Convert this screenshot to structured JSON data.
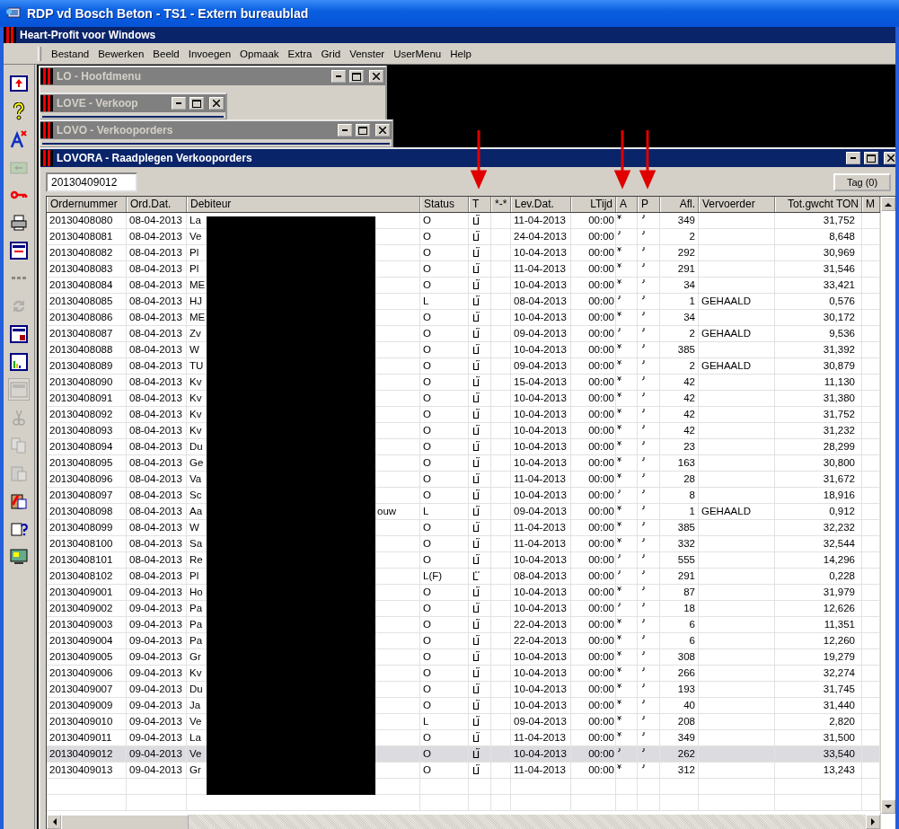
{
  "window": {
    "title": "RDP vd Bosch Beton - TS1 - Extern bureaublad"
  },
  "app_bar": {
    "title": "Heart-Profit voor Windows"
  },
  "menu": [
    "Bestand",
    "Bewerken",
    "Beeld",
    "Invoegen",
    "Opmaak",
    "Extra",
    "Grid",
    "Venster",
    "UserMenu",
    "Help"
  ],
  "toolbar": [
    {
      "kind": "exit",
      "disabled": false
    },
    {
      "kind": "help",
      "disabled": false
    },
    {
      "kind": "font",
      "disabled": false
    },
    {
      "kind": "folder",
      "disabled": true
    },
    {
      "kind": "key",
      "disabled": false
    },
    {
      "kind": "printer",
      "disabled": false
    },
    {
      "kind": "form",
      "disabled": false
    },
    {
      "kind": "dots",
      "disabled": true
    },
    {
      "kind": "refresh",
      "disabled": true
    },
    {
      "kind": "form_lock",
      "disabled": false
    },
    {
      "kind": "chart",
      "disabled": false
    },
    {
      "kind": "window",
      "disabled": true
    },
    {
      "kind": "scissors",
      "disabled": true
    },
    {
      "kind": "copy",
      "disabled": true
    },
    {
      "kind": "paste",
      "disabled": true
    },
    {
      "kind": "clipboard",
      "disabled": false
    },
    {
      "kind": "clipboard_help",
      "disabled": false
    },
    {
      "kind": "monitor",
      "disabled": false
    }
  ],
  "child_windows": [
    {
      "title": "LO - Hoofdmenu"
    },
    {
      "title": "LOVE - Verkoop"
    },
    {
      "title": "LOVO - Verkooporders"
    }
  ],
  "main_window": {
    "title": "LOVORA - Raadplegen Verkooporders",
    "search_value": "20130409012",
    "tag_button": "Tag (0)"
  },
  "table": {
    "columns": [
      "Ordernummer",
      "Ord.Dat.",
      "Debiteur",
      "Status",
      "T",
      "*-*",
      "Lev.Dat.",
      "LTijd",
      "A",
      "P",
      "Afl.",
      "Vervoerder",
      "Tot.gwcht TON",
      "M"
    ],
    "rows": [
      {
        "ordernummer": "20130408080",
        "ord_dat": "08-04-2013",
        "debiteur": "La",
        "status": "O",
        "t_alternate": false,
        "lev_dat": "11-04-2013",
        "ltijd": "00:00",
        "a_marked": true,
        "afl": "349",
        "tot": "31,752",
        "selected": false
      },
      {
        "ordernummer": "20130408081",
        "ord_dat": "08-04-2013",
        "debiteur": "Ve",
        "status": "O",
        "t_alternate": false,
        "lev_dat": "24-04-2013",
        "ltijd": "00:00",
        "a_marked": false,
        "afl": "2",
        "tot": "8,648",
        "selected": false
      },
      {
        "ordernummer": "20130408082",
        "ord_dat": "08-04-2013",
        "debiteur": "Pl",
        "status": "O",
        "t_alternate": false,
        "lev_dat": "10-04-2013",
        "ltijd": "00:00",
        "a_marked": true,
        "afl": "292",
        "tot": "30,969",
        "selected": false
      },
      {
        "ordernummer": "20130408083",
        "ord_dat": "08-04-2013",
        "debiteur": "Pl",
        "status": "O",
        "t_alternate": false,
        "lev_dat": "11-04-2013",
        "ltijd": "00:00",
        "a_marked": true,
        "afl": "291",
        "tot": "31,546",
        "selected": false
      },
      {
        "ordernummer": "20130408084",
        "ord_dat": "08-04-2013",
        "debiteur": "ME",
        "status": "O",
        "t_alternate": false,
        "lev_dat": "10-04-2013",
        "ltijd": "00:00",
        "a_marked": true,
        "afl": "34",
        "tot": "33,421",
        "selected": false
      },
      {
        "ordernummer": "20130408085",
        "ord_dat": "08-04-2013",
        "debiteur": "HJ",
        "status": "L",
        "t_alternate": false,
        "lev_dat": "08-04-2013",
        "ltijd": "00:00",
        "a_marked": false,
        "afl": "1",
        "vervoerder": "GEHAALD",
        "tot": "0,576",
        "selected": false
      },
      {
        "ordernummer": "20130408086",
        "ord_dat": "08-04-2013",
        "debiteur": "ME",
        "status": "O",
        "t_alternate": false,
        "lev_dat": "10-04-2013",
        "ltijd": "00:00",
        "a_marked": true,
        "afl": "34",
        "tot": "30,172",
        "selected": false
      },
      {
        "ordernummer": "20130408087",
        "ord_dat": "08-04-2013",
        "debiteur": "Zv",
        "status": "O",
        "t_alternate": false,
        "lev_dat": "09-04-2013",
        "ltijd": "00:00",
        "a_marked": false,
        "afl": "2",
        "vervoerder": "GEHAALD",
        "tot": "9,536",
        "selected": false
      },
      {
        "ordernummer": "20130408088",
        "ord_dat": "08-04-2013",
        "debiteur": "W",
        "status": "O",
        "t_alternate": false,
        "lev_dat": "10-04-2013",
        "ltijd": "00:00",
        "a_marked": true,
        "afl": "385",
        "tot": "31,392",
        "selected": false
      },
      {
        "ordernummer": "20130408089",
        "ord_dat": "08-04-2013",
        "debiteur": "TU",
        "status": "O",
        "t_alternate": false,
        "lev_dat": "09-04-2013",
        "ltijd": "00:00",
        "a_marked": true,
        "afl": "2",
        "vervoerder": "GEHAALD",
        "tot": "30,879",
        "selected": false
      },
      {
        "ordernummer": "20130408090",
        "ord_dat": "08-04-2013",
        "debiteur": "Kv",
        "status": "O",
        "t_alternate": false,
        "lev_dat": "15-04-2013",
        "ltijd": "00:00",
        "a_marked": true,
        "afl": "42",
        "tot": "11,130",
        "selected": false
      },
      {
        "ordernummer": "20130408091",
        "ord_dat": "08-04-2013",
        "debiteur": "Kv",
        "status": "O",
        "t_alternate": false,
        "lev_dat": "10-04-2013",
        "ltijd": "00:00",
        "a_marked": true,
        "afl": "42",
        "tot": "31,380",
        "selected": false
      },
      {
        "ordernummer": "20130408092",
        "ord_dat": "08-04-2013",
        "debiteur": "Kv",
        "status": "O",
        "t_alternate": false,
        "lev_dat": "10-04-2013",
        "ltijd": "00:00",
        "a_marked": true,
        "afl": "42",
        "tot": "31,752",
        "selected": false
      },
      {
        "ordernummer": "20130408093",
        "ord_dat": "08-04-2013",
        "debiteur": "Kv",
        "status": "O",
        "t_alternate": false,
        "lev_dat": "10-04-2013",
        "ltijd": "00:00",
        "a_marked": true,
        "afl": "42",
        "tot": "31,232",
        "selected": false
      },
      {
        "ordernummer": "20130408094",
        "ord_dat": "08-04-2013",
        "debiteur": "Du",
        "status": "O",
        "t_alternate": false,
        "lev_dat": "10-04-2013",
        "ltijd": "00:00",
        "a_marked": true,
        "afl": "23",
        "tot": "28,299",
        "selected": false
      },
      {
        "ordernummer": "20130408095",
        "ord_dat": "08-04-2013",
        "debiteur": "Ge",
        "status": "O",
        "t_alternate": false,
        "lev_dat": "10-04-2013",
        "ltijd": "00:00",
        "a_marked": true,
        "afl": "163",
        "tot": "30,800",
        "selected": false
      },
      {
        "ordernummer": "20130408096",
        "ord_dat": "08-04-2013",
        "debiteur": "Va",
        "status": "O",
        "t_alternate": false,
        "lev_dat": "11-04-2013",
        "ltijd": "00:00",
        "a_marked": true,
        "afl": "28",
        "tot": "31,672",
        "selected": false
      },
      {
        "ordernummer": "20130408097",
        "ord_dat": "08-04-2013",
        "debiteur": "Sc",
        "status": "O",
        "t_alternate": false,
        "lev_dat": "10-04-2013",
        "ltijd": "00:00",
        "a_marked": false,
        "afl": "8",
        "tot": "18,916",
        "selected": false
      },
      {
        "ordernummer": "20130408098",
        "ord_dat": "08-04-2013",
        "debiteur": "Aa",
        "debiteur_tail": "ouw",
        "status": "L",
        "t_alternate": false,
        "lev_dat": "09-04-2013",
        "ltijd": "00:00",
        "a_marked": true,
        "afl": "1",
        "vervoerder": "GEHAALD",
        "tot": "0,912",
        "selected": false
      },
      {
        "ordernummer": "20130408099",
        "ord_dat": "08-04-2013",
        "debiteur": "W",
        "status": "O",
        "t_alternate": false,
        "lev_dat": "11-04-2013",
        "ltijd": "00:00",
        "a_marked": true,
        "afl": "385",
        "tot": "32,232",
        "selected": false
      },
      {
        "ordernummer": "20130408100",
        "ord_dat": "08-04-2013",
        "debiteur": "Sa",
        "status": "O",
        "t_alternate": false,
        "lev_dat": "11-04-2013",
        "ltijd": "00:00",
        "a_marked": true,
        "afl": "332",
        "tot": "32,544",
        "selected": false
      },
      {
        "ordernummer": "20130408101",
        "ord_dat": "08-04-2013",
        "debiteur": "Re",
        "status": "O",
        "t_alternate": false,
        "lev_dat": "10-04-2013",
        "ltijd": "00:00",
        "a_marked": false,
        "afl": "555",
        "tot": "14,296",
        "selected": false
      },
      {
        "ordernummer": "20130408102",
        "ord_dat": "08-04-2013",
        "debiteur": "Pl",
        "status": "L(F)",
        "t_alternate": true,
        "lev_dat": "08-04-2013",
        "ltijd": "00:00",
        "a_marked": false,
        "afl": "291",
        "tot": "0,228",
        "selected": false
      },
      {
        "ordernummer": "20130409001",
        "ord_dat": "09-04-2013",
        "debiteur": "Ho",
        "status": "O",
        "t_alternate": false,
        "lev_dat": "10-04-2013",
        "ltijd": "00:00",
        "a_marked": true,
        "afl": "87",
        "tot": "31,979",
        "selected": false
      },
      {
        "ordernummer": "20130409002",
        "ord_dat": "09-04-2013",
        "debiteur": "Pa",
        "status": "O",
        "t_alternate": false,
        "lev_dat": "10-04-2013",
        "ltijd": "00:00",
        "a_marked": false,
        "afl": "18",
        "tot": "12,626",
        "selected": false
      },
      {
        "ordernummer": "20130409003",
        "ord_dat": "09-04-2013",
        "debiteur": "Pa",
        "status": "O",
        "t_alternate": false,
        "lev_dat": "22-04-2013",
        "ltijd": "00:00",
        "a_marked": true,
        "afl": "6",
        "tot": "11,351",
        "selected": false
      },
      {
        "ordernummer": "20130409004",
        "ord_dat": "09-04-2013",
        "debiteur": "Pa",
        "status": "O",
        "t_alternate": false,
        "lev_dat": "22-04-2013",
        "ltijd": "00:00",
        "a_marked": true,
        "afl": "6",
        "tot": "12,260",
        "selected": false
      },
      {
        "ordernummer": "20130409005",
        "ord_dat": "09-04-2013",
        "debiteur": "Gr",
        "status": "O",
        "t_alternate": false,
        "lev_dat": "10-04-2013",
        "ltijd": "00:00",
        "a_marked": true,
        "afl": "308",
        "tot": "19,279",
        "selected": false
      },
      {
        "ordernummer": "20130409006",
        "ord_dat": "09-04-2013",
        "debiteur": "Kv",
        "status": "O",
        "t_alternate": false,
        "lev_dat": "10-04-2013",
        "ltijd": "00:00",
        "a_marked": true,
        "afl": "266",
        "tot": "32,274",
        "selected": false
      },
      {
        "ordernummer": "20130409007",
        "ord_dat": "09-04-2013",
        "debiteur": "Du",
        "status": "O",
        "t_alternate": false,
        "lev_dat": "10-04-2013",
        "ltijd": "00:00",
        "a_marked": true,
        "afl": "193",
        "tot": "31,745",
        "selected": false
      },
      {
        "ordernummer": "20130409009",
        "ord_dat": "09-04-2013",
        "debiteur": "Ja",
        "status": "O",
        "t_alternate": false,
        "lev_dat": "10-04-2013",
        "ltijd": "00:00",
        "a_marked": true,
        "afl": "40",
        "tot": "31,440",
        "selected": false
      },
      {
        "ordernummer": "20130409010",
        "ord_dat": "09-04-2013",
        "debiteur": "Ve",
        "status": "L",
        "t_alternate": false,
        "lev_dat": "09-04-2013",
        "ltijd": "00:00",
        "a_marked": true,
        "afl": "208",
        "tot": "2,820",
        "selected": false
      },
      {
        "ordernummer": "20130409011",
        "ord_dat": "09-04-2013",
        "debiteur": "La",
        "status": "O",
        "t_alternate": false,
        "lev_dat": "11-04-2013",
        "ltijd": "00:00",
        "a_marked": true,
        "afl": "349",
        "tot": "31,500",
        "selected": false
      },
      {
        "ordernummer": "20130409012",
        "ord_dat": "09-04-2013",
        "debiteur": "Ve",
        "status": "O",
        "t_alternate": false,
        "lev_dat": "10-04-2013",
        "ltijd": "00:00",
        "a_marked": false,
        "afl": "262",
        "tot": "33,540",
        "selected": true
      },
      {
        "ordernummer": "20130409013",
        "ord_dat": "09-04-2013",
        "debiteur": "Gr",
        "status": "O",
        "t_alternate": false,
        "lev_dat": "11-04-2013",
        "ltijd": "00:00",
        "a_marked": true,
        "afl": "312",
        "tot": "13,243",
        "selected": false
      }
    ]
  }
}
